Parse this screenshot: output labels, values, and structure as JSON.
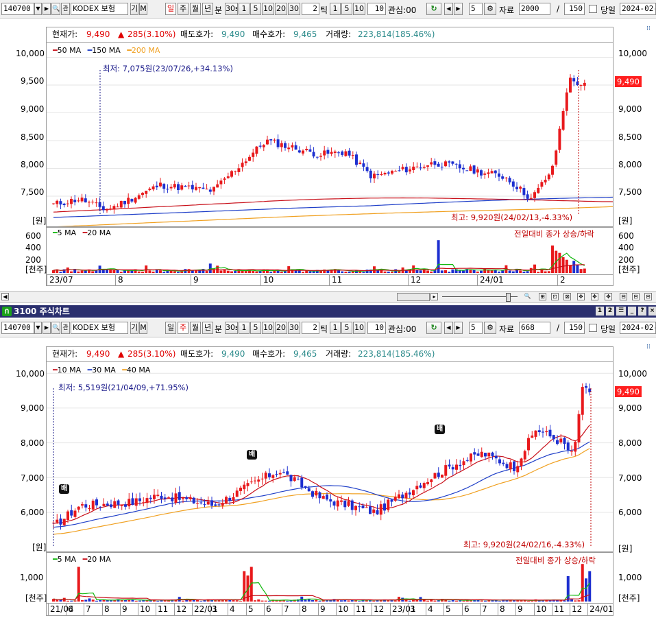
{
  "top": {
    "toolbar": {
      "code": "140700",
      "name": "KODEX 보험",
      "gi": "기",
      "m": "M",
      "periods": [
        "일",
        "주",
        "월",
        "년"
      ],
      "bun": "분",
      "bun_vals": [
        "30s",
        "1",
        "5",
        "10",
        "20",
        "30"
      ],
      "tick_val": "2",
      "tick_label": "틱",
      "tick_vals": [
        "1",
        "5",
        "10"
      ],
      "tick_input": "10",
      "gwansim": "관심:00",
      "gwansim_input": "5",
      "jaryo_label": "자료",
      "jaryo_value": "2000",
      "count_value": "150",
      "dangil_label": "당일",
      "date_value": "2024-02-"
    },
    "info": {
      "current_label": "현재가:",
      "current_value": "9,490",
      "change_value": "285(3.10%)",
      "ask_label": "매도호가:",
      "ask_value": "9,490",
      "bid_label": "매수호가:",
      "bid_value": "9,465",
      "volume_label": "거래량:",
      "volume_value": "223,814(185.46%)"
    },
    "legend": [
      "50 MA",
      "150 MA",
      "200 MA"
    ],
    "price_axis": [
      "10,000",
      "9,500",
      "9,000",
      "8,500",
      "8,000",
      "7,500"
    ],
    "unit_won": "[원]",
    "low_note": "최저: 7,075원(23/07/26,+34.13%)",
    "high_note": "최고: 9,920원(24/02/13,-4.33%)",
    "price_box": "9,490",
    "vol_legend": [
      "5 MA",
      "20 MA"
    ],
    "vol_note": "전일대비 종가 상승/하락",
    "vol_axis": [
      "600",
      "400",
      "200"
    ],
    "unit_k": "[천주]",
    "x_labels": [
      "23/07",
      "8",
      "9",
      "10",
      "11",
      "12",
      "24/01",
      "2"
    ]
  },
  "bottom": {
    "header_title": "3100 주식차트",
    "toolbar": {
      "code": "140700",
      "name": "KODEX 보험",
      "gi": "기",
      "m": "M",
      "periods": [
        "일",
        "주",
        "월",
        "년"
      ],
      "bun": "분",
      "bun_vals": [
        "30s",
        "1",
        "5",
        "10",
        "20",
        "30"
      ],
      "tick_val": "2",
      "tick_label": "틱",
      "tick_vals": [
        "1",
        "5",
        "10"
      ],
      "tick_input": "10",
      "gwansim": "관심:00",
      "gwansim_input": "5",
      "jaryo_label": "자료",
      "jaryo_value": "668",
      "count_value": "150",
      "dangil_label": "당일",
      "date_value": "2024-02-"
    },
    "info": {
      "current_label": "현재가:",
      "current_value": "9,490",
      "change_value": "285(3.10%)",
      "ask_label": "매도호가:",
      "ask_value": "9,490",
      "bid_label": "매수호가:",
      "bid_value": "9,465",
      "volume_label": "거래량:",
      "volume_value": "223,814(185.46%)"
    },
    "legend": [
      "10 MA",
      "30 MA",
      "40 MA"
    ],
    "price_axis": [
      "10,000",
      "9,000",
      "8,000",
      "7,000",
      "6,000"
    ],
    "unit_won": "[원]",
    "low_note": "최저: 5,519원(21/04/09,+71.95%)",
    "high_note": "최고: 9,920원(24/02/16,-4.33%)",
    "price_box": "9,490",
    "flag_text": "배",
    "vol_legend": [
      "5 MA",
      "20 MA"
    ],
    "vol_note": "전일대비 종가 상승/하락",
    "vol_axis": [
      "1,000"
    ],
    "unit_k": "[천주]",
    "x_labels": [
      "21/04",
      "6",
      "7",
      "8",
      "9",
      "10",
      "11",
      "12",
      "22/01",
      "3",
      "4",
      "5",
      "6",
      "7",
      "8",
      "9",
      "10",
      "11",
      "12",
      "23/01",
      "3",
      "4",
      "5",
      "6",
      "7",
      "8",
      "9",
      "10",
      "11",
      "12",
      "24/01"
    ]
  },
  "colors": {
    "up": "#e8191c",
    "down": "#1d2fd0",
    "ma_red": "#c8101a",
    "ma_blue": "#1f3fc8",
    "ma_orange": "#f0a020",
    "ma_green": "#13b80f",
    "header": "#2a2f6e",
    "price_box": "#ff1f1f"
  }
}
